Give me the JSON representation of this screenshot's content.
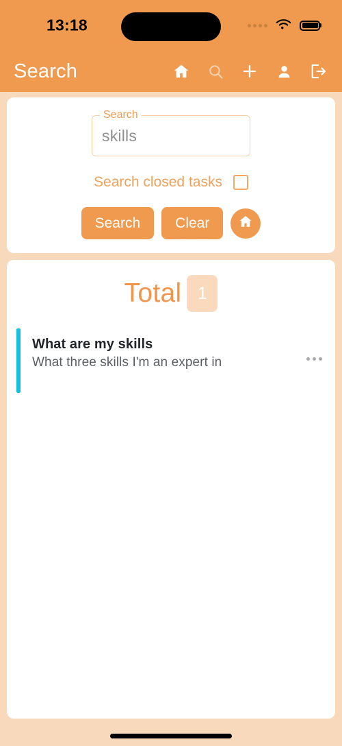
{
  "status_bar": {
    "time": "13:18",
    "signal_icon": "signal-dots-icon",
    "wifi_icon": "wifi-icon",
    "battery_icon": "battery-full-icon"
  },
  "app_bar": {
    "title": "Search",
    "actions": [
      {
        "name": "home-icon",
        "label": "Home"
      },
      {
        "name": "search-icon",
        "label": "Search"
      },
      {
        "name": "plus-icon",
        "label": "Add"
      },
      {
        "name": "person-icon",
        "label": "Profile"
      },
      {
        "name": "logout-icon",
        "label": "Logout"
      }
    ]
  },
  "search_card": {
    "field": {
      "label": "Search",
      "value": "skills",
      "placeholder": "skills"
    },
    "closed_tasks": {
      "label": "Search closed tasks",
      "checked": false
    },
    "search_button": "Search",
    "clear_button": "Clear",
    "home_fab_icon": "home-icon"
  },
  "results_card": {
    "total_label": "Total",
    "total_count": "1",
    "tasks": [
      {
        "title": "What are my skills",
        "subtitle": "What three skills I'm an expert in",
        "accent_color": "#16C0DE",
        "menu_icon": "more-horizontal-icon"
      }
    ]
  },
  "colors": {
    "brand_orange": "#EF9A4F",
    "page_background": "#F9D9BC",
    "card_background": "#FFFFFF",
    "badge_background": "#FAD9BC",
    "accent_cyan": "#16C0DE",
    "field_border": "#F6CEA6",
    "muted_text": "#8E8E8E"
  }
}
